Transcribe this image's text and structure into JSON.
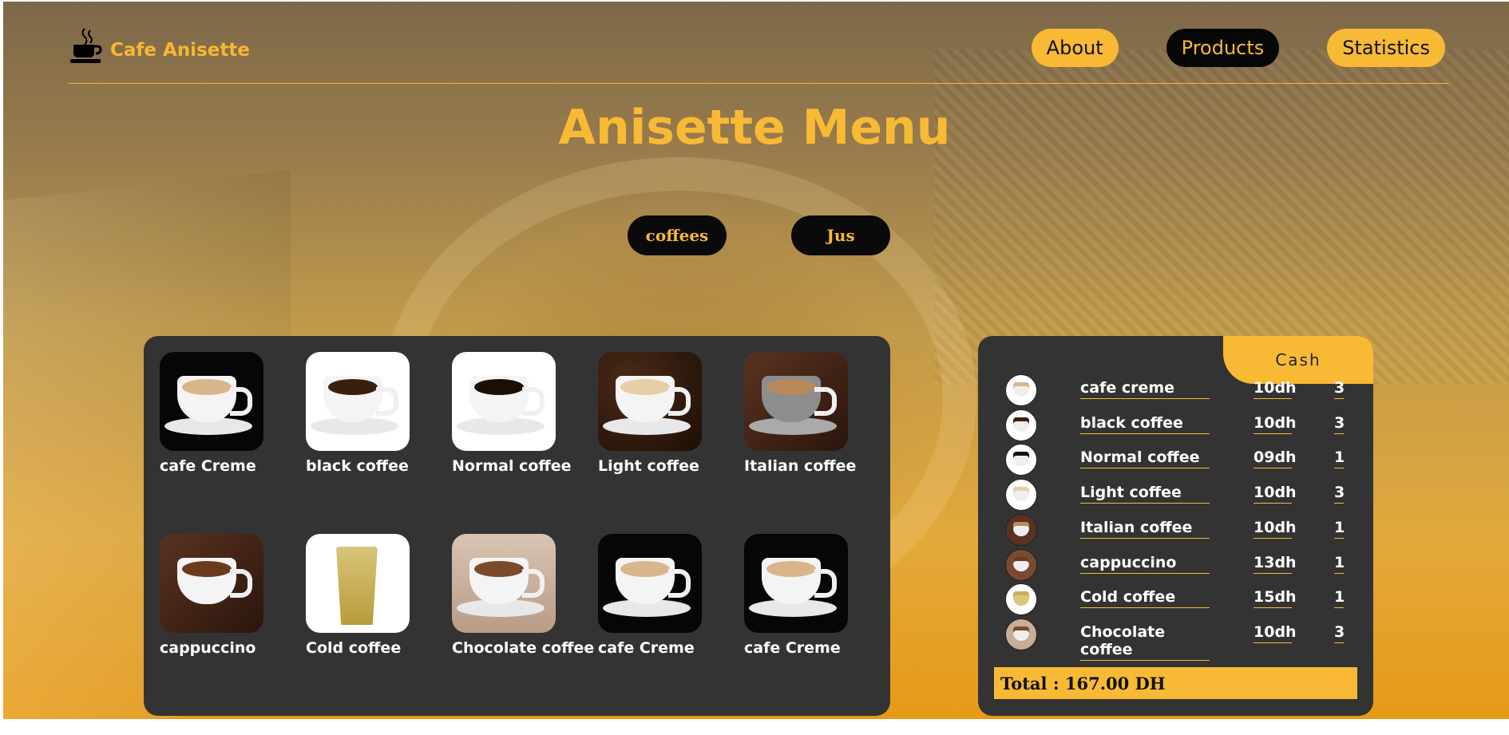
{
  "brand": {
    "name": "Cafe Anisette",
    "icon": "coffee-cup-icon"
  },
  "nav": {
    "items": [
      {
        "label": "About",
        "active": false
      },
      {
        "label": "Products",
        "active": true
      },
      {
        "label": "Statistics",
        "active": false
      }
    ]
  },
  "menu": {
    "title": "Anisette Menu"
  },
  "categories": [
    {
      "label": "coffees"
    },
    {
      "label": "Jus"
    }
  ],
  "products": [
    {
      "label": "cafe Creme"
    },
    {
      "label": "black coffee"
    },
    {
      "label": "Normal coffee"
    },
    {
      "label": "Light coffee"
    },
    {
      "label": "Italian coffee"
    },
    {
      "label": "cappuccino"
    },
    {
      "label": "Cold coffee"
    },
    {
      "label": "Chocolate coffee"
    },
    {
      "label": "cafe Creme"
    },
    {
      "label": "cafe Creme"
    }
  ],
  "order": {
    "cash_label": "Cash",
    "items": [
      {
        "name": "cafe creme",
        "price": "10dh",
        "qty": "3"
      },
      {
        "name": "black coffee",
        "price": "10dh",
        "qty": "3"
      },
      {
        "name": "Normal coffee",
        "price": "09dh",
        "qty": "1"
      },
      {
        "name": "Light coffee",
        "price": "10dh",
        "qty": "3"
      },
      {
        "name": "Italian coffee",
        "price": "10dh",
        "qty": "1"
      },
      {
        "name": "cappuccino",
        "price": "13dh",
        "qty": "1"
      },
      {
        "name": "Cold coffee",
        "price": "15dh",
        "qty": "1"
      },
      {
        "name": "Chocolate coffee",
        "price": "10dh",
        "qty": "3"
      }
    ],
    "total": "Total : 167.00 DH"
  },
  "colors": {
    "accent": "#f8b935",
    "panel": "#333333",
    "dark": "#070707"
  }
}
